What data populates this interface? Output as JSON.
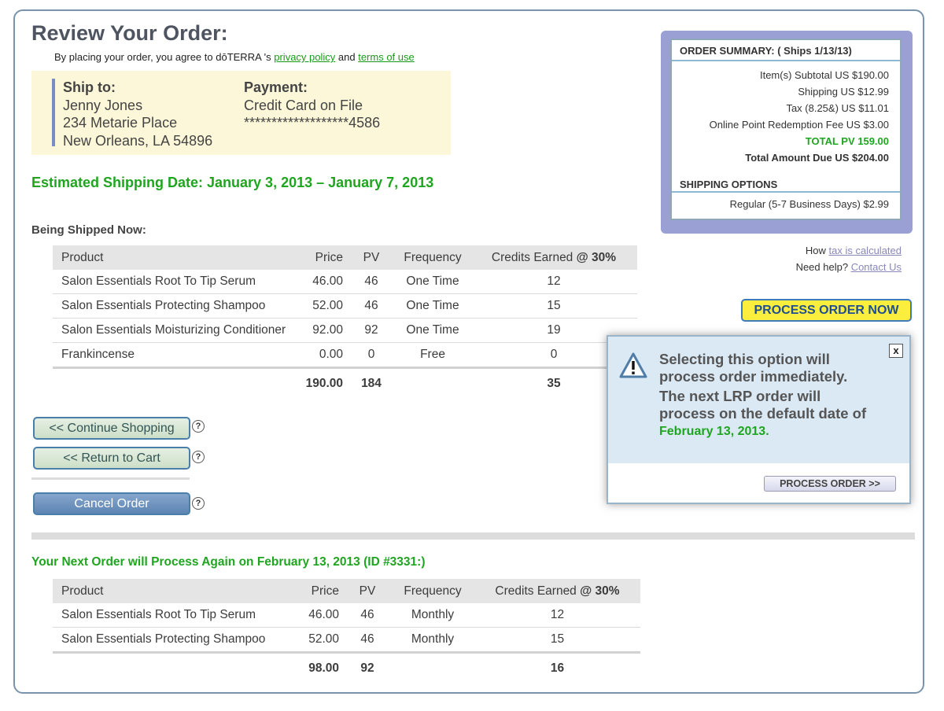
{
  "page_title": "Review Your Order:",
  "agreement": {
    "prefix": "By placing your order, you agree to dōTERRA 's ",
    "privacy_link": "privacy policy",
    "middle": " and ",
    "terms_link": "terms of use "
  },
  "ship_to": {
    "heading": "Ship to:",
    "name": "Jenny Jones",
    "street": "234 Metarie Place",
    "city_state_zip": "New Orleans, LA  54896"
  },
  "payment": {
    "heading": "Payment:",
    "method": "Credit Card on File",
    "card_masked": "*******************4586"
  },
  "estimated_shipping": "Estimated Shipping Date: January 3, 2013 – January 7, 2013",
  "being_shipped": {
    "heading": "Being Shipped Now:",
    "columns": [
      "Product",
      "Price",
      "PV",
      "Frequency",
      "Credits Earned",
      "@ 30%"
    ],
    "rows": [
      {
        "product": "Salon Essentials Root To Tip Serum",
        "price": "46.00",
        "pv": "46",
        "frequency": "One Time",
        "credits": "12"
      },
      {
        "product": "Salon Essentials Protecting Shampoo",
        "price": "52.00",
        "pv": "46",
        "frequency": "One Time",
        "credits": "15"
      },
      {
        "product": "Salon Essentials Moisturizing Conditioner",
        "price": "92.00",
        "pv": "92",
        "frequency": "One Time",
        "credits": "19"
      },
      {
        "product": "Frankincense",
        "price": "0.00",
        "pv": "0",
        "frequency": "Free",
        "credits": "0"
      }
    ],
    "totals": {
      "price": "190.00",
      "pv": "184",
      "credits": "35"
    }
  },
  "buttons": {
    "continue_shopping": "<< Continue Shopping",
    "return_to_cart": "<< Return to Cart",
    "cancel_order": "Cancel Order",
    "help_glyph": "?"
  },
  "next_order": {
    "heading": "Your Next Order will Process Again on February 13, 2013 (ID #3331:)",
    "columns": [
      "Product",
      "Price",
      "PV",
      "Frequency",
      "Credits Earned",
      "@ 30%"
    ],
    "rows": [
      {
        "product": "Salon Essentials Root To Tip Serum",
        "price": "46.00",
        "pv": "46",
        "frequency": "Monthly",
        "credits": "12"
      },
      {
        "product": "Salon Essentials Protecting Shampoo",
        "price": "52.00",
        "pv": "46",
        "frequency": "Monthly",
        "credits": "15"
      }
    ],
    "totals": {
      "price": "98.00",
      "pv": "92",
      "credits": "16"
    }
  },
  "order_summary": {
    "heading": "ORDER SUMMARY: ( Ships 1/13/13)",
    "subtotal": "Item(s) Subtotal  US $190.00",
    "shipping": "Shipping  US $12.99",
    "tax": "Tax (8.25&)  US $11.01",
    "redemption_fee": "Online Point Redemption Fee  US $3.00",
    "total_pv": "TOTAL PV 159.00",
    "total_due": "Total Amount Due US $204.00",
    "shipping_options_heading": "SHIPPING OPTIONS",
    "shipping_option": "Regular (5-7 Business Days)  $2.99"
  },
  "side_links": {
    "tax_prefix": "How ",
    "tax_link": "tax is calculated",
    "help_prefix": "Need help?  ",
    "help_link": "Contact Us"
  },
  "process_order_now": "PROCESS ORDER NOW",
  "popup": {
    "close": "x",
    "line1": "Selecting this option will",
    "line2": "process order immediately.",
    "line3": "The next LRP order will",
    "line4": "process on the default date of",
    "date": "February 13, 2013.",
    "button": "PROCESS ORDER >>"
  },
  "colors": {
    "accent_green": "#1fa51f",
    "frame_blue": "#7a93ad",
    "summary_purple": "#9aa0d4",
    "process_yellow": "#fbee3c"
  }
}
